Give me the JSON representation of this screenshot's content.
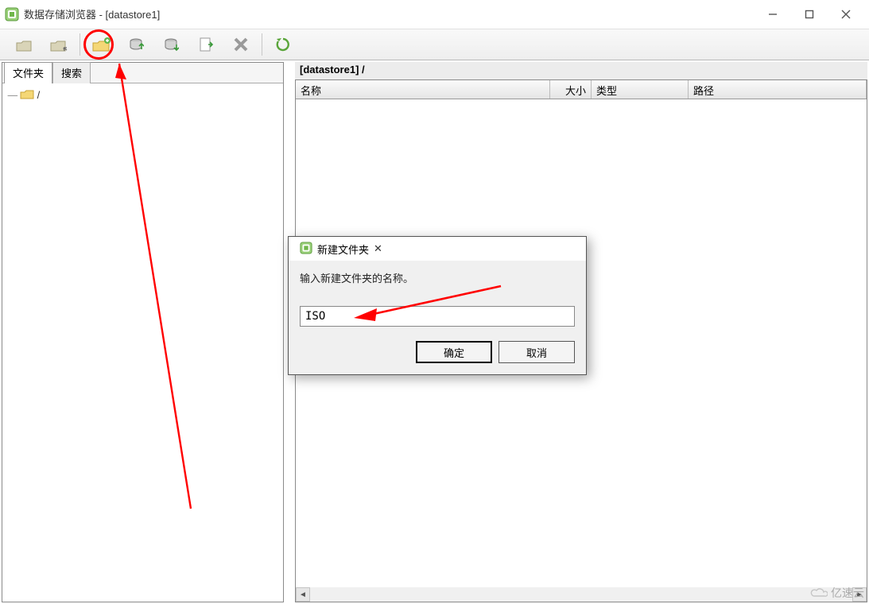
{
  "window": {
    "title": "数据存储浏览器 - [datastore1]"
  },
  "toolbar": {
    "buttons": [
      "navigate-up-icon",
      "navigate-home-icon",
      "new-folder-icon",
      "upload-icon",
      "download-icon",
      "export-icon",
      "delete-icon",
      "refresh-icon"
    ]
  },
  "left": {
    "tab_folders": "文件夹",
    "tab_search": "搜索",
    "root_label": "/"
  },
  "right": {
    "path": "[datastore1] /",
    "columns": {
      "name": "名称",
      "size": "大小",
      "type": "类型",
      "path": "路径"
    }
  },
  "dialog": {
    "title": "新建文件夹",
    "prompt": "输入新建文件夹的名称。",
    "value": "ISO",
    "ok": "确定",
    "cancel": "取消"
  },
  "watermark": "亿速云"
}
